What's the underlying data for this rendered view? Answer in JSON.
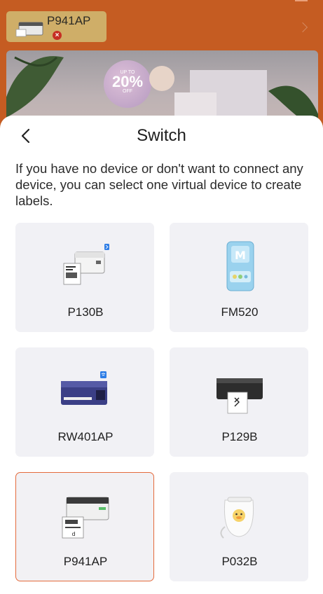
{
  "background": {
    "device_chip": {
      "name": "P941AP",
      "status_icon": "error-x-icon"
    },
    "banner": {
      "promo_upto": "UP TO",
      "promo_percent": "20%",
      "promo_off": "OFF"
    }
  },
  "sheet": {
    "title": "Switch",
    "back_icon": "chevron-left-icon",
    "description": "If you have no device or don't want to connect any device, you can select one virtual device to create labels.",
    "devices": [
      {
        "label": "P130B",
        "image": "white-label-printer-bluetooth",
        "selected": false
      },
      {
        "label": "FM520",
        "image": "blue-portable-label-maker",
        "selected": false
      },
      {
        "label": "RW401AP",
        "image": "blue-shipping-printer-wifi",
        "selected": false
      },
      {
        "label": "P129B",
        "image": "black-label-printer",
        "selected": false
      },
      {
        "label": "P941AP",
        "image": "white-shipping-printer",
        "selected": true
      },
      {
        "label": "P032B",
        "image": "white-mini-printer-duck",
        "selected": false
      }
    ]
  },
  "colors": {
    "app_background": "#c55c22",
    "card_background": "#f1f1f5",
    "selected_border": "#e46a3c"
  }
}
